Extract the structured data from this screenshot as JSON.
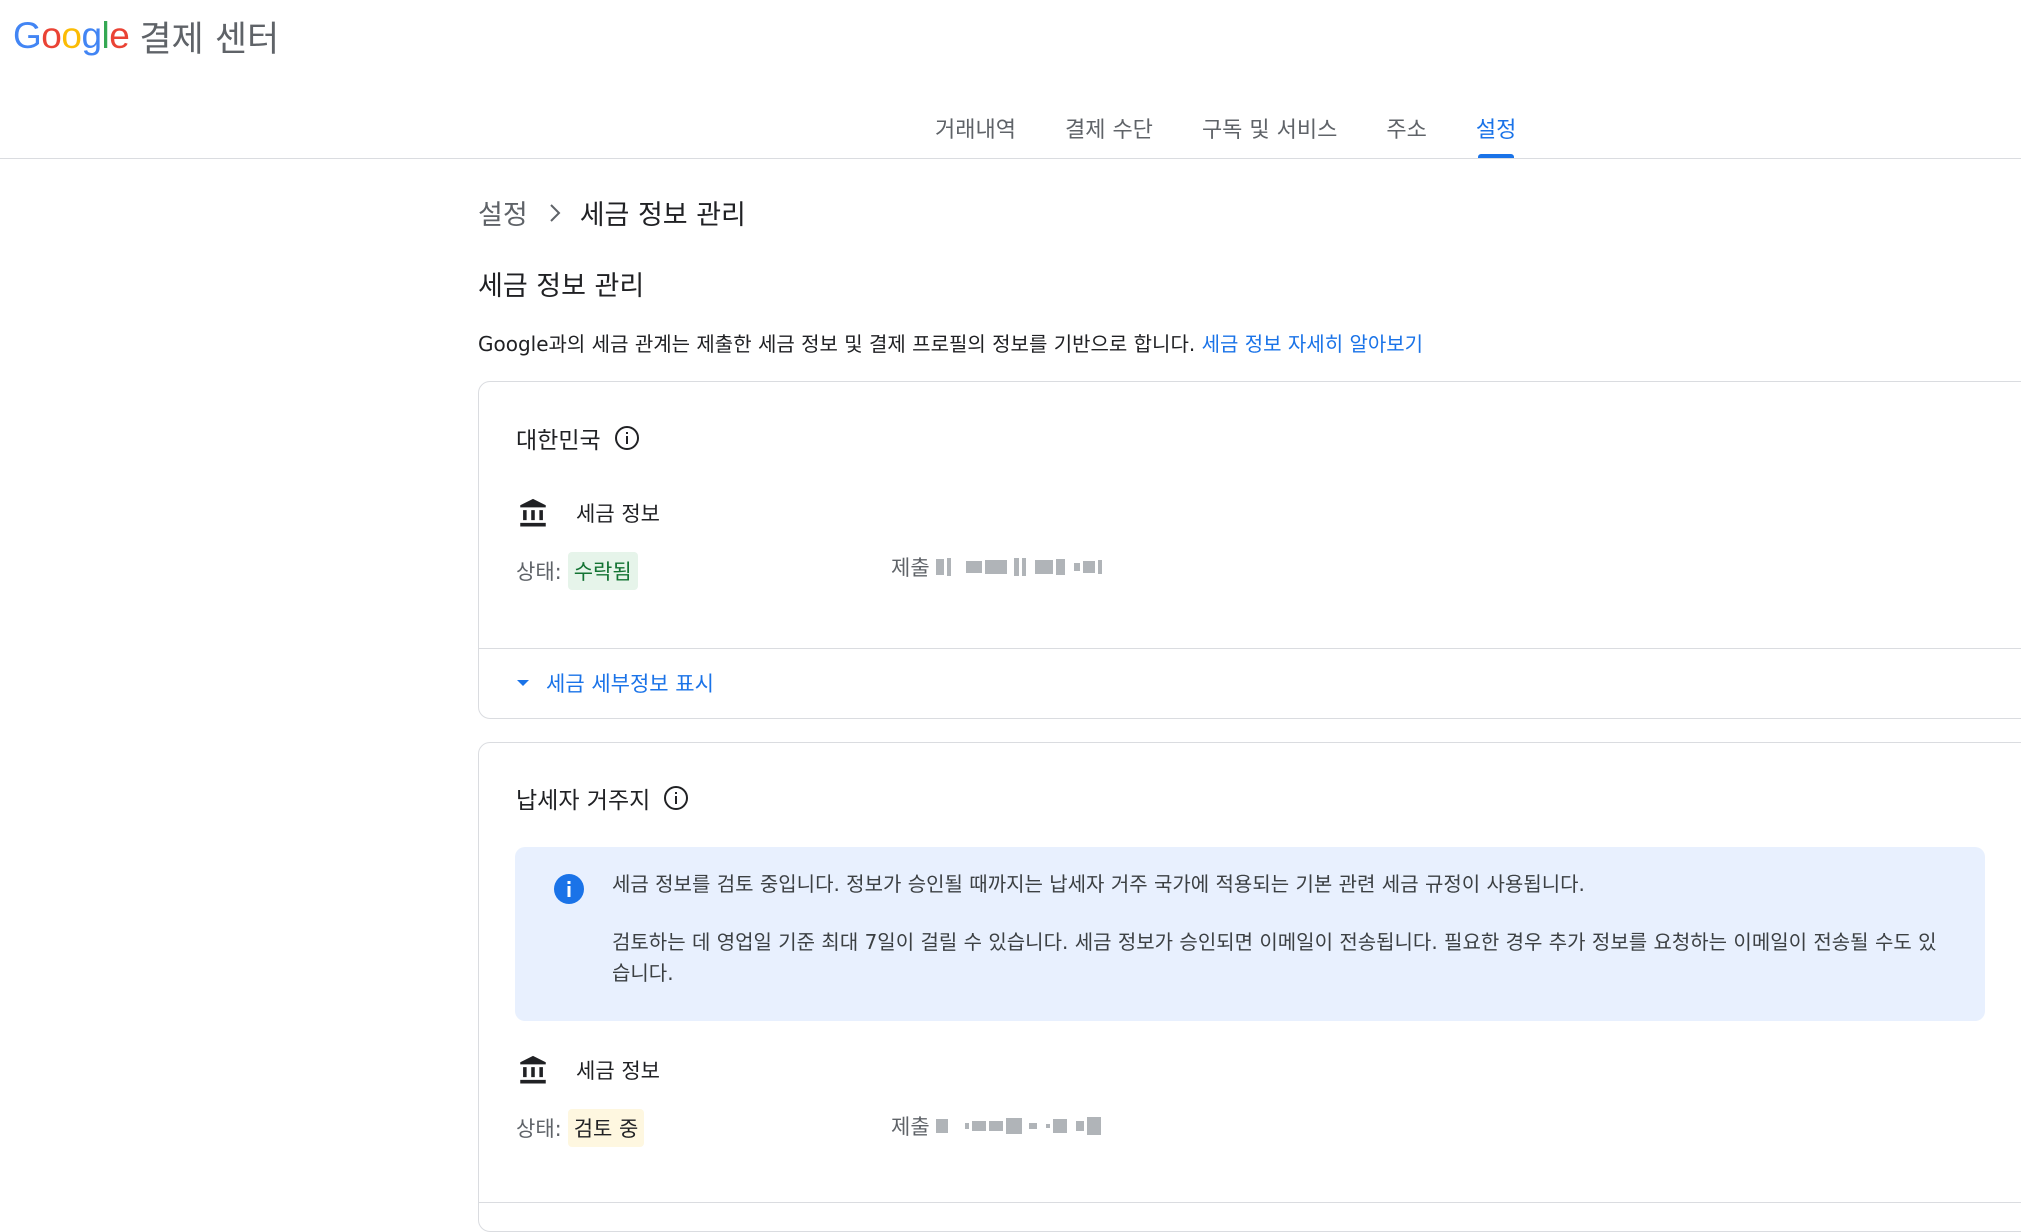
{
  "header": {
    "logo_google": "Google",
    "product_name": "결제 센터"
  },
  "nav": {
    "tabs": [
      {
        "label": "거래내역",
        "active": false
      },
      {
        "label": "결제 수단",
        "active": false
      },
      {
        "label": "구독 및 서비스",
        "active": false
      },
      {
        "label": "주소",
        "active": false
      },
      {
        "label": "설정",
        "active": true
      }
    ]
  },
  "breadcrumb": {
    "parent": "설정",
    "current": "세금 정보 관리"
  },
  "page": {
    "title": "세금 정보 관리",
    "description": "Google과의 세금 관계는 제출한 세금 정보 및 결제 프로필의 정보를 기반으로 합니다.",
    "learn_more_link": "세금 정보 자세히 알아보기"
  },
  "cards": [
    {
      "title": "대한민국",
      "section_label": "세금 정보",
      "status_label": "상태:",
      "status_value": "수락됨",
      "submitted_label": "제출",
      "expander_label": "세금 세부정보 표시"
    },
    {
      "title": "납세자 거주지",
      "notice_line1": "세금 정보를 검토 중입니다. 정보가 승인될 때까지는 납세자 거주 국가에 적용되는 기본 관련 세금 규정이 사용됩니다.",
      "notice_line2": "검토하는 데 영업일 기준 최대 7일이 걸릴 수 있습니다. 세금 정보가 승인되면 이메일이 전송됩니다. 필요한 경우 추가 정보를 요청하는 이메일이 전송될 수도 있습니다.",
      "section_label": "세금 정보",
      "status_label": "상태:",
      "status_value": "검토 중",
      "submitted_label": "제출"
    }
  ],
  "colors": {
    "accent": "#1a73e8",
    "accepted_bg": "#e6f4ea",
    "accepted_text": "#137333",
    "review_bg": "#fef7e0",
    "notice_bg": "#e8f0fe"
  },
  "icons": [
    "info-icon",
    "bank-icon",
    "chevron-right-icon",
    "arrow-drop-down-icon"
  ]
}
